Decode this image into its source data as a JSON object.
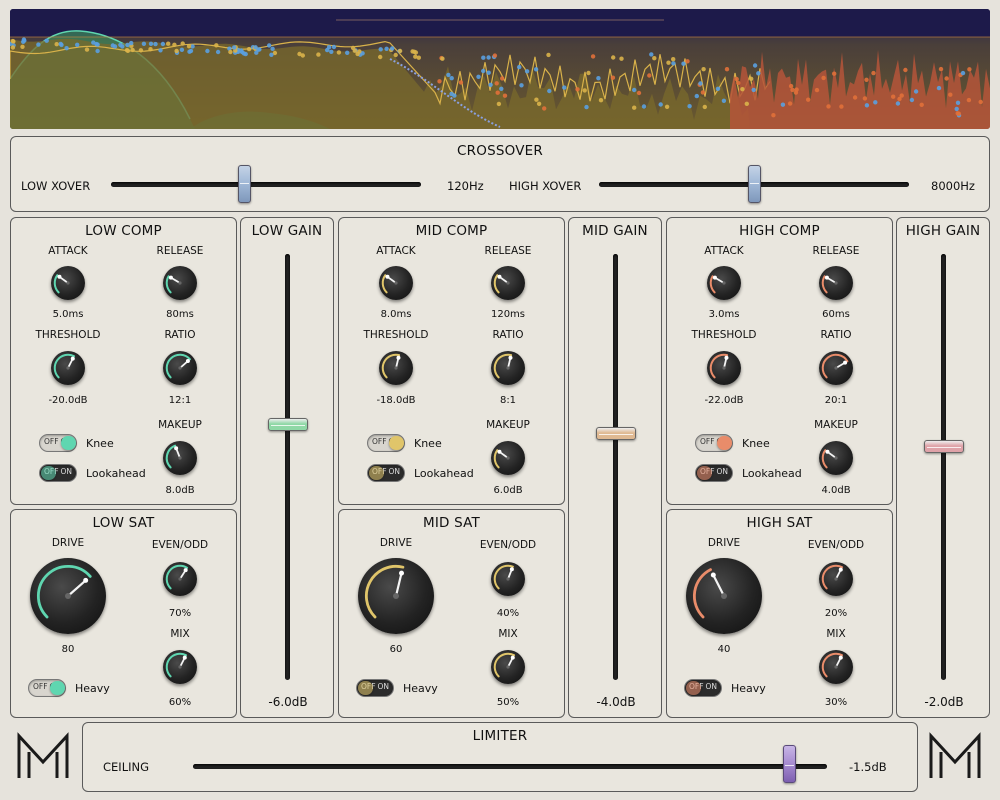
{
  "colors": {
    "low": "#5fd6b0",
    "mid": "#e0c56a",
    "high": "#e98c6a",
    "low_gain_thumb": "#8fd8a6",
    "mid_gain_thumb": "#dfb992",
    "high_gain_thumb": "#dfa2a8",
    "xover_thumb": "#9fb7d6",
    "limiter_thumb": "#a58ad0",
    "analyzer_bg": "#1d1a4a"
  },
  "crossover": {
    "title": "CROSSOVER",
    "low_label": "LOW XOVER",
    "low_value": "120Hz",
    "low_pos": 0.43,
    "high_label": "HIGH XOVER",
    "high_value": "8000Hz",
    "high_pos": 0.5
  },
  "bands": [
    {
      "comp": {
        "title": "LOW COMP",
        "attack_label": "ATTACK",
        "attack_value": "5.0ms",
        "attack_pos": 0.3,
        "release_label": "RELEASE",
        "release_value": "80ms",
        "release_pos": 0.28,
        "threshold_label": "THRESHOLD",
        "threshold_value": "-20.0dB",
        "threshold_pos": 0.6,
        "ratio_label": "RATIO",
        "ratio_value": "12:1",
        "ratio_pos": 0.68,
        "knee_label": "Knee",
        "knee_on": true,
        "lookahead_label": "Lookahead",
        "lookahead_on": false,
        "makeup_label": "MAKEUP",
        "makeup_value": "8.0dB",
        "makeup_pos": 0.42
      },
      "sat": {
        "title": "LOW SAT",
        "drive_label": "DRIVE",
        "drive_value": "80",
        "drive_pos": 0.68,
        "evenodd_label": "EVEN/ODD",
        "evenodd_value": "70%",
        "evenodd_pos": 0.62,
        "mix_label": "MIX",
        "mix_value": "60%",
        "mix_pos": 0.6,
        "heavy_label": "Heavy",
        "heavy_on": true
      },
      "gain": {
        "title": "LOW GAIN",
        "value": "-6.0dB",
        "pos": 0.4
      }
    },
    {
      "comp": {
        "title": "MID COMP",
        "attack_label": "ATTACK",
        "attack_value": "8.0ms",
        "attack_pos": 0.3,
        "release_label": "RELEASE",
        "release_value": "120ms",
        "release_pos": 0.3,
        "threshold_label": "THRESHOLD",
        "threshold_value": "-18.0dB",
        "threshold_pos": 0.55,
        "ratio_label": "RATIO",
        "ratio_value": "8:1",
        "ratio_pos": 0.55,
        "knee_label": "Knee",
        "knee_on": true,
        "lookahead_label": "Lookahead",
        "lookahead_on": false,
        "makeup_label": "MAKEUP",
        "makeup_value": "6.0dB",
        "makeup_pos": 0.3
      },
      "sat": {
        "title": "MID SAT",
        "drive_label": "DRIVE",
        "drive_value": "60",
        "drive_pos": 0.55,
        "evenodd_label": "EVEN/ODD",
        "evenodd_value": "40%",
        "evenodd_pos": 0.58,
        "mix_label": "MIX",
        "mix_value": "50%",
        "mix_pos": 0.6,
        "heavy_label": "Heavy",
        "heavy_on": false
      },
      "gain": {
        "title": "MID GAIN",
        "value": "-4.0dB",
        "pos": 0.42
      }
    },
    {
      "comp": {
        "title": "HIGH COMP",
        "attack_label": "ATTACK",
        "attack_value": "3.0ms",
        "attack_pos": 0.28,
        "release_label": "RELEASE",
        "release_value": "60ms",
        "release_pos": 0.28,
        "threshold_label": "THRESHOLD",
        "threshold_value": "-22.0dB",
        "threshold_pos": 0.55,
        "ratio_label": "RATIO",
        "ratio_value": "20:1",
        "ratio_pos": 0.72,
        "knee_label": "Knee",
        "knee_on": true,
        "lookahead_label": "Lookahead",
        "lookahead_on": false,
        "makeup_label": "MAKEUP",
        "makeup_value": "4.0dB",
        "makeup_pos": 0.3
      },
      "sat": {
        "title": "HIGH SAT",
        "drive_label": "DRIVE",
        "drive_value": "40",
        "drive_pos": 0.4,
        "evenodd_label": "EVEN/ODD",
        "evenodd_value": "20%",
        "evenodd_pos": 0.6,
        "mix_label": "MIX",
        "mix_value": "30%",
        "mix_pos": 0.6,
        "heavy_label": "Heavy",
        "heavy_on": false
      },
      "gain": {
        "title": "HIGH GAIN",
        "value": "-2.0dB",
        "pos": 0.45
      }
    }
  ],
  "toggle_text": {
    "off": "OFF",
    "on": "ON"
  },
  "limiter": {
    "title": "LIMITER",
    "ceiling_label": "CEILING",
    "ceiling_value": "-1.5dB",
    "ceiling_pos": 0.94
  },
  "logo": {
    "left_icon": "m-logo-icon",
    "right_icon": "m-logo-icon"
  }
}
